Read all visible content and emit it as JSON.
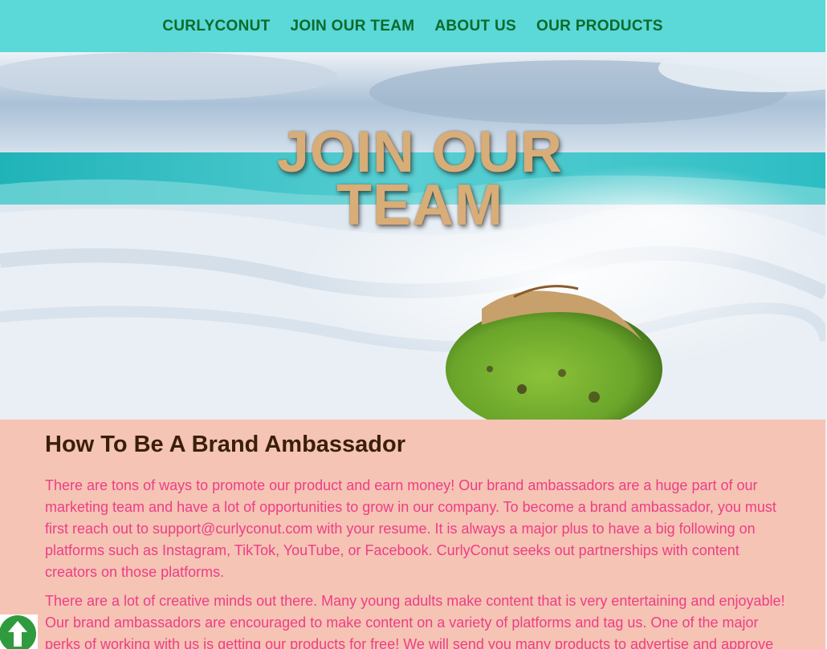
{
  "nav": {
    "items": [
      {
        "label": "CURLYCONUT"
      },
      {
        "label": "JOIN OUR TEAM"
      },
      {
        "label": "ABOUT US"
      },
      {
        "label": "OUR PRODUCTS"
      }
    ]
  },
  "hero": {
    "title_line1": "JOIN OUR",
    "title_line2": "TEAM"
  },
  "main": {
    "heading": "How To Be A Brand Ambassador",
    "paragraph1": "There are tons of ways to promote our product and earn money! Our brand ambassadors are a huge part of our marketing team and have a lot of opportunities to grow in our company. To become a brand ambassador, you must first reach out to support@curlyconut.com with your resume. It is always a major plus to have a big following on platforms such as Instagram, TikTok, YouTube, or Facebook. CurlyConut seeks out partnerships with content creators on those platforms.",
    "paragraph2": "There are a lot of creative minds out there. Many young adults make content that is very entertaining and enjoyable! Our brand ambassadors are encouraged to make content on a variety of platforms and tag us. One of the major perks of working with us is getting our products for free! We will send you many products to advertise and approve"
  },
  "colors": {
    "nav_bg": "#5bd8d8",
    "nav_text": "#0b6b2a",
    "content_bg": "#f5c4b4",
    "heading_text": "#3a1f0a",
    "paragraph_text": "#ee3d86",
    "hero_title": "#d8ad78",
    "back_to_top": "#2f9a3e"
  },
  "icons": {
    "back_to_top": "arrow-up-circle-icon"
  }
}
